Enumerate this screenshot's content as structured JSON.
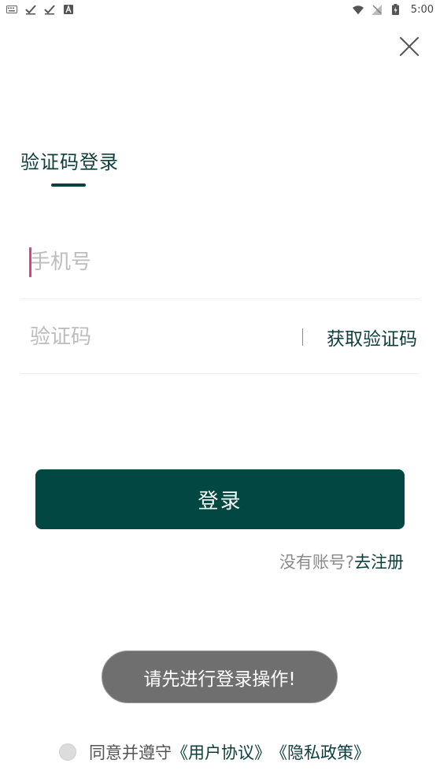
{
  "status_bar": {
    "time": "5:00",
    "left_icons": [
      "keyboard-icon",
      "check-icon",
      "check-icon",
      "a-icon"
    ],
    "right_icons": [
      "wifi-icon",
      "signal-icon",
      "battery-icon"
    ]
  },
  "header": {
    "close_icon": "close-icon"
  },
  "login": {
    "title": "验证码登录",
    "phone_placeholder": "手机号",
    "code_placeholder": "验证码",
    "get_code_label": "获取验证码",
    "submit_label": "登录",
    "register_prompt": "没有账号?",
    "register_link": "去注册"
  },
  "toast": {
    "message": "请先进行登录操作!"
  },
  "agreement": {
    "text": "同意并遵守",
    "user_agreement": "《用户协议》",
    "privacy_policy": "《隐私政策》"
  },
  "colors": {
    "primary": "#034742",
    "text_dark": "#0e3e3a",
    "placeholder": "#bdbdbd",
    "cursor": "#e23e78",
    "toast_bg": "#6f6f6f"
  }
}
